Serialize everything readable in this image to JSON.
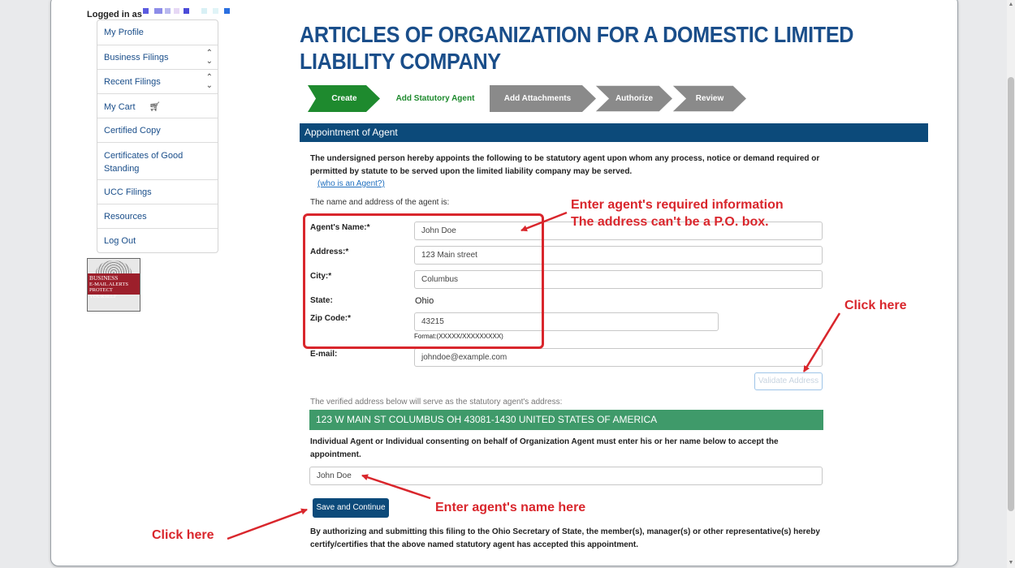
{
  "logged_in_label": "Logged in as",
  "sidebar": {
    "items": [
      {
        "label": "My Profile",
        "chevron": false
      },
      {
        "label": "Business Filings",
        "chevron": true
      },
      {
        "label": "Recent Filings",
        "chevron": true
      },
      {
        "label": "My Cart",
        "chevron": false,
        "icon": "cart-icon"
      },
      {
        "label": "Certified Copy",
        "chevron": false
      },
      {
        "label": "Certificates of Good Standing",
        "chevron": false
      },
      {
        "label": "UCC Filings",
        "chevron": false
      },
      {
        "label": "Resources",
        "chevron": false
      },
      {
        "label": "Log Out",
        "chevron": false
      }
    ]
  },
  "badge": {
    "line1": "BUSINESS",
    "line2": "E-MAIL ALERTS",
    "line3": "PROTECT YOURSELF"
  },
  "page_title": "ARTICLES OF ORGANIZATION FOR A DOMESTIC LIMITED LIABILITY COMPANY",
  "steps": [
    {
      "label": "Create",
      "state": "complete"
    },
    {
      "label": "Add Statutory Agent",
      "state": "current"
    },
    {
      "label": "Add Attachments",
      "state": "pending"
    },
    {
      "label": "Authorize",
      "state": "pending"
    },
    {
      "label": "Review",
      "state": "pending"
    }
  ],
  "section_title": "Appointment of Agent",
  "intro_text": "The undersigned person hereby appoints the following to be statutory agent upon whom any process, notice or demand required or permitted by statute to be served upon the limited liability company may be served.",
  "who_link": "(who is an Agent?)",
  "name_address_label": "The name and address of the agent is:",
  "form": {
    "name_label": "Agent's Name:*",
    "name_value": "John Doe",
    "address_label": "Address:*",
    "address_value": "123 Main street",
    "city_label": "City:*",
    "city_value": "Columbus",
    "state_label": "State:",
    "state_value": "Ohio",
    "zip_label": "Zip Code:*",
    "zip_value": "43215",
    "zip_format": "Format:(XXXXX/XXXXXXXXX)",
    "email_label": "E-mail:",
    "email_value": "johndoe@example.com"
  },
  "validate_button": "Validate Address",
  "verified_note": "The verified address below will serve as the statutory agent's address:",
  "verified_address": "123 W MAIN ST COLUMBUS OH 43081-1430 UNITED STATES OF AMERICA",
  "consent_text": "Individual Agent or Individual consenting on behalf of Organization Agent must enter his or her name below to accept the appointment.",
  "signature_value": "John Doe",
  "save_button": "Save and Continue",
  "authorize_text": "By authorizing and submitting this filing to the Ohio Secretary of State, the member(s), manager(s) or other representative(s) hereby certify/certifies that the above named statutory agent has accepted this appointment.",
  "annotations": {
    "agent_info_line1": "Enter agent's required information",
    "agent_info_line2": "The address can't be a P.O. box.",
    "click_here_validate": "Click here",
    "enter_name": "Enter agent's name here",
    "click_here_save": "Click here"
  },
  "colors": {
    "brand_blue": "#0c4a7a",
    "step_complete": "#1e8a2e",
    "step_pending": "#8a8a8a",
    "verified_green": "#3f9a6a",
    "annotation_red": "#d9262c"
  }
}
